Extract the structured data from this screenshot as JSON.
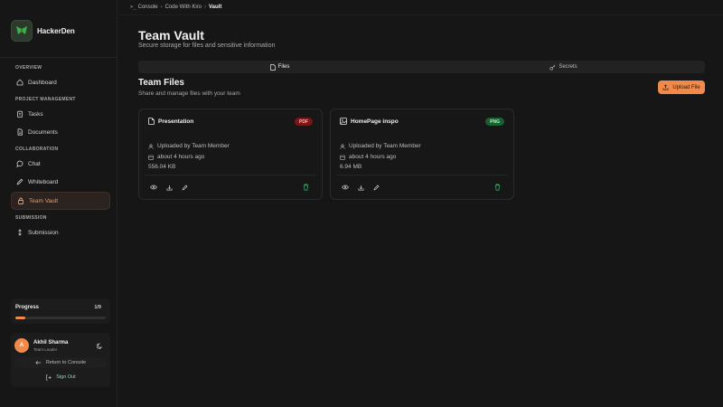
{
  "brand": {
    "name": "HackerDen"
  },
  "sidebar": {
    "sections": [
      {
        "label": "OVERVIEW"
      },
      {
        "label": "PROJECT MANAGEMENT"
      },
      {
        "label": "COLLABORATION"
      },
      {
        "label": "SUBMISSION"
      }
    ],
    "items": [
      {
        "label": "Dashboard",
        "icon": "home-icon"
      },
      {
        "label": "Tasks",
        "icon": "clipboard-icon"
      },
      {
        "label": "Documents",
        "icon": "document-icon"
      },
      {
        "label": "Chat",
        "icon": "chat-icon"
      },
      {
        "label": "Whiteboard",
        "icon": "pencil-icon"
      },
      {
        "label": "Team Vault",
        "icon": "lock-icon",
        "active": true
      },
      {
        "label": "Submission",
        "icon": "upload-icon"
      }
    ],
    "progress": {
      "label": "Progress",
      "count": "1/9",
      "fraction": 0.111
    },
    "user": {
      "initial": "A",
      "name": "Akhil Sharma",
      "role": "Team Leader"
    },
    "return_label": "Return to Console",
    "signout_label": "Sign Out"
  },
  "breadcrumb": {
    "items": [
      "Console",
      "Code With Kiro",
      "Vault"
    ]
  },
  "page": {
    "title": "Team Vault",
    "subtitle": "Secure storage for files and sensitive information"
  },
  "tabs": [
    {
      "label": "Files"
    },
    {
      "label": "Secrets"
    }
  ],
  "files_section": {
    "title": "Team Files",
    "subtitle": "Share and manage files with your team",
    "upload_label": "Upload File"
  },
  "files": [
    {
      "name": "Presentation",
      "type": "PDF",
      "uploader": "Uploaded by Team Member",
      "time": "about 4 hours ago",
      "size": "556.04 KB"
    },
    {
      "name": "HomePage inspo",
      "type": "PNG",
      "uploader": "Uploaded by Team Member",
      "time": "about 4 hours ago",
      "size": "6.94 MB"
    }
  ],
  "colors": {
    "accent": "#ef8a4b",
    "background": "#161616",
    "pdf_badge": "#7a1616",
    "png_badge": "#18602f",
    "signout": "#8fd8b0"
  }
}
